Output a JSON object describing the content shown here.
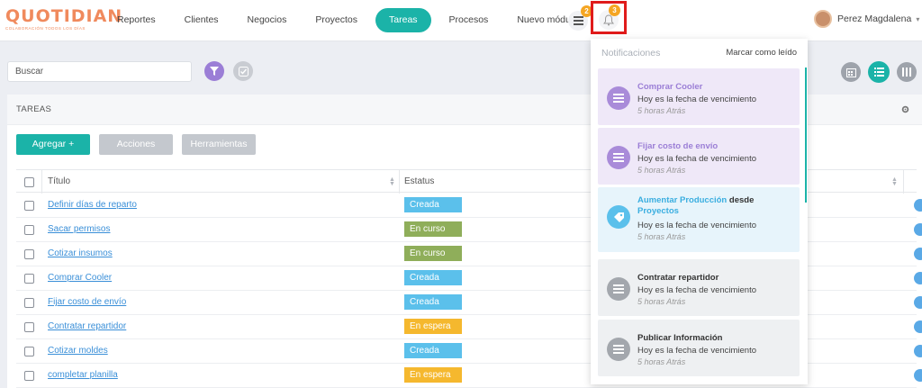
{
  "logo": {
    "word": "QUOTIDIAN",
    "tagline": "COLABORACIÓN TODOS LOS DÍAS"
  },
  "nav": [
    {
      "label": "Reportes"
    },
    {
      "label": "Clientes"
    },
    {
      "label": "Negocios"
    },
    {
      "label": "Proyectos"
    },
    {
      "label": "Tareas",
      "active": true
    },
    {
      "label": "Procesos"
    },
    {
      "label": "Nuevo módulo"
    }
  ],
  "topbar": {
    "tasks_icon": "task-list-icon",
    "tasks_badge": "2",
    "bell_icon": "bell-icon",
    "bell_badge": "3",
    "user_name": "Perez Magdalena"
  },
  "search": {
    "placeholder": "Buscar"
  },
  "panel": {
    "title": "TAREAS",
    "buttons": {
      "add": "Agregar +",
      "actions": "Acciones",
      "tools": "Herramientas"
    },
    "columns": {
      "title": "Título",
      "status": "Estatus"
    }
  },
  "tasks": [
    {
      "title": "Definir días de reparto",
      "status": "Creada"
    },
    {
      "title": "Sacar permisos",
      "status": "En curso"
    },
    {
      "title": "Cotizar insumos",
      "status": "En curso"
    },
    {
      "title": "Comprar Cooler",
      "status": "Creada"
    },
    {
      "title": "Fijar costo de envío",
      "status": "Creada"
    },
    {
      "title": "Contratar repartidor",
      "status": "En espera"
    },
    {
      "title": "Cotizar moldes",
      "status": "Creada"
    },
    {
      "title": "completar planilla",
      "status": "En espera"
    }
  ],
  "status_colors": {
    "Creada": "#5bc0eb",
    "En curso": "#8fae5a",
    "En espera": "#f5b82e"
  },
  "colors": {
    "accent": "#1bb3a8",
    "purple": "#9b7ed6",
    "link": "#3a8fd8",
    "highlight": "#e01b1b"
  },
  "notifications": {
    "title": "Notificaciones",
    "mark_read": "Marcar como leído",
    "items": [
      {
        "title": "Comprar Cooler",
        "line": "Hoy es la fecha de vencimiento",
        "time": "5 horas Atrás",
        "style": "purple",
        "icon": "list-icon"
      },
      {
        "title": "Fijar costo de envío",
        "line": "Hoy es la fecha de vencimiento",
        "time": "5 horas Atrás",
        "style": "purple",
        "icon": "list-icon"
      },
      {
        "title": "Aumentar Producción",
        "title_mid": "desde",
        "title_end": "Proyectos",
        "line": "Hoy es la fecha de vencimiento",
        "time": "5 horas Atrás",
        "style": "blue",
        "icon": "tag-icon"
      },
      {
        "title": "Contratar repartidor",
        "line": "Hoy es la fecha de vencimiento",
        "time": "5 horas Atrás",
        "style": "gray",
        "icon": "list-icon"
      },
      {
        "title": "Publicar Información",
        "line": "Hoy es la fecha de vencimiento",
        "time": "5 horas Atrás",
        "style": "gray",
        "icon": "list-icon"
      }
    ]
  }
}
